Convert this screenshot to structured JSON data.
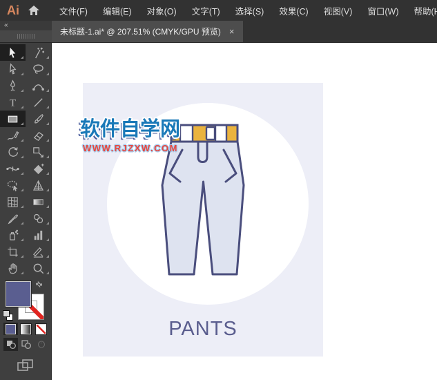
{
  "menu_bar": {
    "logo": "Ai",
    "items": [
      "文件(F)",
      "编辑(E)",
      "对象(O)",
      "文字(T)",
      "选择(S)",
      "效果(C)",
      "视图(V)",
      "窗口(W)",
      "帮助(H)"
    ]
  },
  "tab_bar": {
    "collapse": "«",
    "tab": {
      "title": "未标题-1.ai* @ 207.51% (CMYK/GPU 预览)",
      "close": "×"
    }
  },
  "tool_panel": {
    "tools": [
      "selection",
      "magic-wand",
      "direct-selection",
      "lasso",
      "pen",
      "curvature",
      "type",
      "line-segment",
      "rectangle",
      "paintbrush",
      "pencil",
      "eraser",
      "rotate",
      "scale",
      "width",
      "shape-builder",
      "shaper",
      "perspective-grid",
      "mesh",
      "gradient",
      "eyedropper",
      "blend",
      "symbol-sprayer",
      "column-graph",
      "artboard",
      "slice",
      "hand",
      "zoom"
    ],
    "selected_tools": [
      "selection",
      "rectangle"
    ],
    "fill_color": "#5a5e90",
    "stroke_color": "none",
    "swatch_buttons": [
      "color",
      "gradient",
      "none"
    ],
    "drawing_modes": [
      "draw-normal",
      "draw-behind",
      "draw-inside"
    ]
  },
  "canvas": {
    "watermark": {
      "title": "软件自学网",
      "url": "WWW.RJZXW.COM"
    },
    "label": "PANTS"
  },
  "theme": {
    "artboard-bg": "#edeef7",
    "pants-fill": "#dee3f0",
    "pants-outline": "#4a4e7d",
    "belt-orange": "#eab33e",
    "wm-blue": "#1a79b8",
    "wm-red": "#e8453c",
    "label-color": "#5a5d8e",
    "fill-swatch": "#5a5e90"
  }
}
